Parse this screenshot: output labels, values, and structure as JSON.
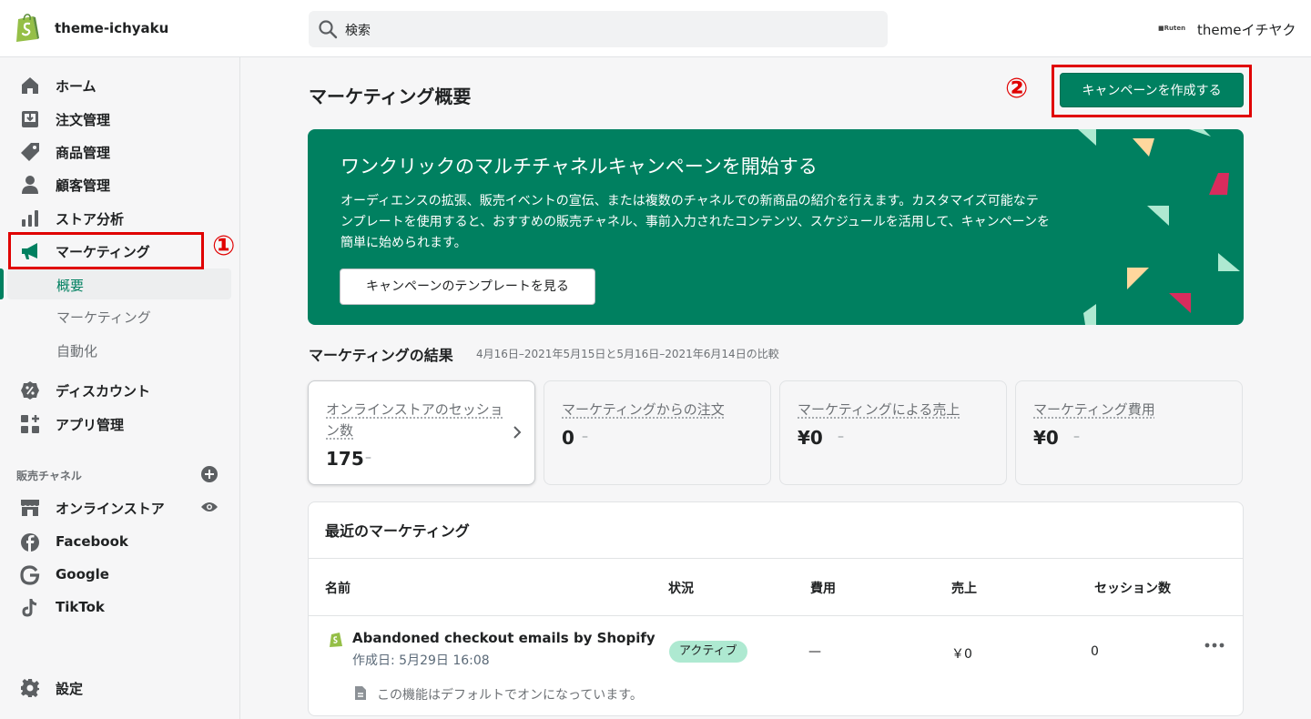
{
  "app": {
    "store_name": "theme-ichyaku",
    "search_placeholder": "検索",
    "account_logo_text": "Ruten",
    "account_name": "themeイチヤク"
  },
  "sidebar": {
    "items": [
      {
        "label": "ホーム",
        "icon": "home-icon"
      },
      {
        "label": "注文管理",
        "icon": "orders-icon"
      },
      {
        "label": "商品管理",
        "icon": "tag-icon"
      },
      {
        "label": "顧客管理",
        "icon": "person-icon"
      },
      {
        "label": "ストア分析",
        "icon": "bar-chart-icon"
      },
      {
        "label": "マーケティング",
        "icon": "megaphone-icon"
      }
    ],
    "marketing_sub": [
      "概要",
      "マーケティング",
      "自動化"
    ],
    "items2": [
      {
        "label": "ディスカウント",
        "icon": "discount-icon"
      },
      {
        "label": "アプリ管理",
        "icon": "apps-icon"
      }
    ],
    "channels_heading": "販売チャネル",
    "channels": [
      {
        "label": "オンラインストア",
        "icon": "store-icon"
      },
      {
        "label": "Facebook",
        "icon": "facebook-icon"
      },
      {
        "label": "Google",
        "icon": "google-icon"
      },
      {
        "label": "TikTok",
        "icon": "tiktok-icon"
      }
    ],
    "settings_label": "設定"
  },
  "annotations": {
    "one": "①",
    "two": "②"
  },
  "main": {
    "title": "マーケティング概要",
    "create_button": "キャンペーンを作成する",
    "hero": {
      "title": "ワンクリックのマルチチャネルキャンペーンを開始する",
      "body": "オーディエンスの拡張、販売イベントの宣伝、または複数のチャネルでの新商品の紹介を行えます。カスタマイズ可能なテンプレートを使用すると、おすすめの販売チャネル、事前入力されたコンテンツ、スケジュールを活用して、キャンペーンを簡単に始められます。",
      "button": "キャンペーンのテンプレートを見る"
    },
    "results": {
      "heading": "マーケティングの結果",
      "subheading": "4月16日–2021年5月15日と5月16日–2021年6月14日の比較",
      "cards": [
        {
          "label": "オンラインストアのセッション数",
          "value": "175",
          "change": "–"
        },
        {
          "label": "マーケティングからの注文",
          "value": "0",
          "change": "–"
        },
        {
          "label": "マーケティングによる売上",
          "value": "¥0",
          "change": "–"
        },
        {
          "label": "マーケティング費用",
          "value": "¥0",
          "change": "–"
        }
      ]
    },
    "recent": {
      "title": "最近のマーケティング",
      "columns": [
        "名前",
        "状況",
        "費用",
        "売上",
        "セッション数"
      ],
      "row": {
        "name": "Abandoned checkout emails by Shopify",
        "date": "作成日: 5月29日 16:08",
        "status": "アクティブ",
        "cost": "—",
        "sales": "￥0",
        "sessions": "0",
        "note": "この機能はデフォルトでオンになっています。"
      }
    }
  },
  "colors": {
    "accent": "#008060",
    "annotation": "#e00000",
    "badge_bg": "#aee9d1"
  }
}
